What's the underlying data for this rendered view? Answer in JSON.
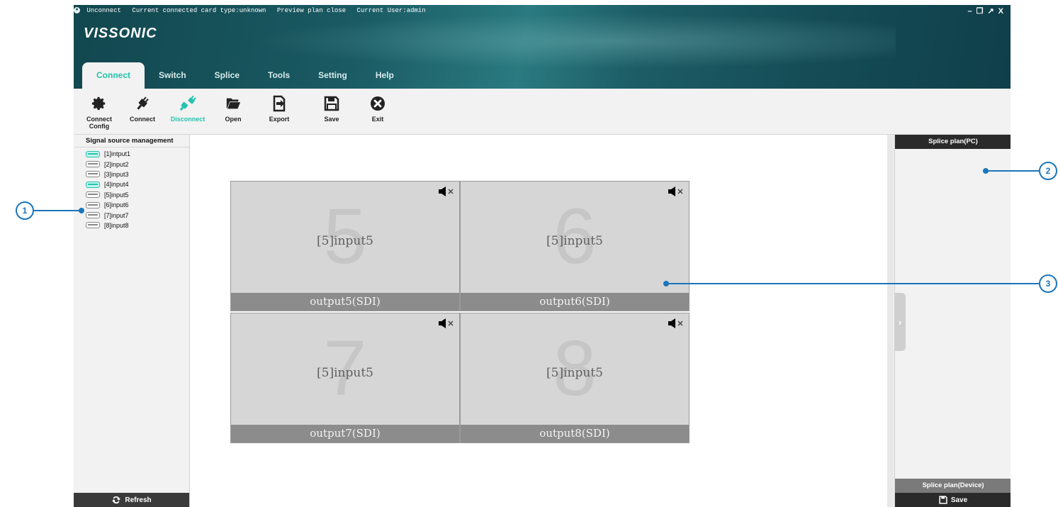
{
  "status_bar": {
    "connection": "Unconnect",
    "card_type": "Current connected card type:unknown",
    "preview": "Preview plan close",
    "user": "Current User:admin"
  },
  "window_controls": {
    "minimize": "–",
    "restore": "❐",
    "popout": "↗",
    "close": "X"
  },
  "logo": "VISSONIC",
  "tabs": [
    "Connect",
    "Switch",
    "Splice",
    "Tools",
    "Setting",
    "Help"
  ],
  "active_tab": "Connect",
  "toolbar": {
    "connect_config": "Connect\nConfig",
    "connect": "Connect",
    "disconnect": "Disconnect",
    "open": "Open",
    "export": "Export",
    "save": "Save",
    "exit": "Exit"
  },
  "signal_panel": {
    "title": "Signal source management",
    "items": [
      {
        "label": "[1]intput1",
        "active": true
      },
      {
        "label": "[2]input2",
        "active": false
      },
      {
        "label": "[3]input3",
        "active": false
      },
      {
        "label": "[4]input4",
        "active": true
      },
      {
        "label": "[5]input5",
        "active": false
      },
      {
        "label": "[6]input6",
        "active": false
      },
      {
        "label": "[7]input7",
        "active": false
      },
      {
        "label": "[8]input8",
        "active": false
      }
    ],
    "refresh_label": "Refresh"
  },
  "video_wall": {
    "cells": [
      {
        "number": "5",
        "source": "[5]input5",
        "output": "output5(SDI)",
        "muted": true
      },
      {
        "number": "6",
        "source": "[5]input5",
        "output": "output6(SDI)",
        "muted": true
      },
      {
        "number": "7",
        "source": "[5]input5",
        "output": "output7(SDI)",
        "muted": true
      },
      {
        "number": "8",
        "source": "[5]input5",
        "output": "output8(SDI)",
        "muted": true
      }
    ]
  },
  "right_panel": {
    "pc_title": "Splice plan(PC)",
    "device_title": "Splice plan(Device)",
    "save_label": "Save"
  },
  "callouts": [
    "1",
    "2",
    "3"
  ],
  "colors": {
    "accent": "#23c3ae",
    "header": "#1a5a63",
    "callout": "#1b75bb"
  }
}
